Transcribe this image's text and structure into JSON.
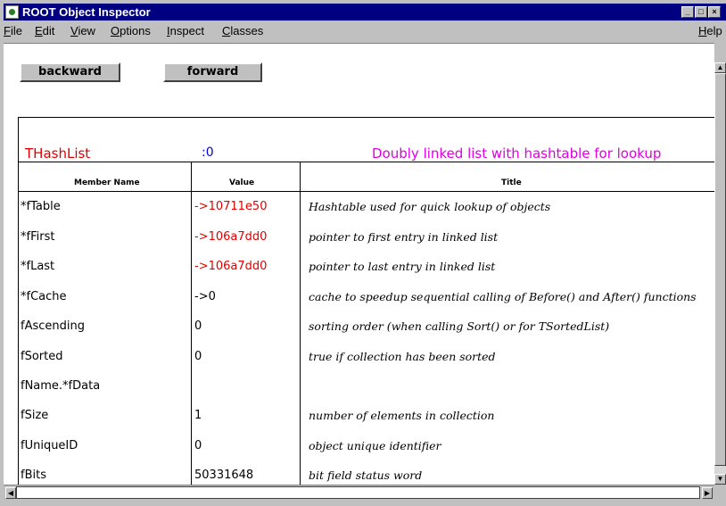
{
  "window": {
    "title": "ROOT Object Inspector",
    "controls": [
      "_",
      "□",
      "×"
    ]
  },
  "menu": [
    {
      "label": "File",
      "u": "F"
    },
    {
      "label": "Edit",
      "u": "E"
    },
    {
      "label": "View",
      "u": "V"
    },
    {
      "label": "Options",
      "u": "O"
    },
    {
      "label": "Inspect",
      "u": "I"
    },
    {
      "label": "Classes",
      "u": "C"
    },
    {
      "label": "Help",
      "u": "H"
    }
  ],
  "nav": {
    "backward": "backward",
    "forward": "forward"
  },
  "header": {
    "class_name": "THashList",
    "value": ":0",
    "title": "Doubly linked list with hashtable for lookup",
    "colors": {
      "class_name": "#e00000",
      "value": "#0000e0",
      "title": "#e000e0"
    }
  },
  "columns": {
    "name": "Member Name",
    "value": "Value",
    "title": "Title"
  },
  "rows": [
    {
      "name": "*fTable",
      "value": "->10711e50",
      "pointer": true,
      "title": "Hashtable used for quick lookup of objects"
    },
    {
      "name": "*fFirst",
      "value": "->106a7dd0",
      "pointer": true,
      "title": "pointer to first entry in linked list"
    },
    {
      "name": "*fLast",
      "value": "->106a7dd0",
      "pointer": true,
      "title": "pointer to last entry in linked list"
    },
    {
      "name": "*fCache",
      "value": "->0",
      "pointer": false,
      "title": "cache to speedup sequential calling of Before() and After() functions"
    },
    {
      "name": "fAscending",
      "value": "0",
      "pointer": false,
      "title": "sorting order (when calling Sort() or for TSortedList)"
    },
    {
      "name": "fSorted",
      "value": "0",
      "pointer": false,
      "title": "true if collection has been sorted"
    },
    {
      "name": "fName.*fData",
      "value": "",
      "pointer": false,
      "title": ""
    },
    {
      "name": "fSize",
      "value": "1",
      "pointer": false,
      "title": "number of elements in collection"
    },
    {
      "name": "fUniqueID",
      "value": "0",
      "pointer": false,
      "title": "object unique identifier"
    },
    {
      "name": "fBits",
      "value": "50331648",
      "pointer": false,
      "title": "bit field status word"
    }
  ],
  "colors": {
    "pointer_value": "#e00000",
    "plain_value": "#000000",
    "title_bar": "#000080"
  }
}
